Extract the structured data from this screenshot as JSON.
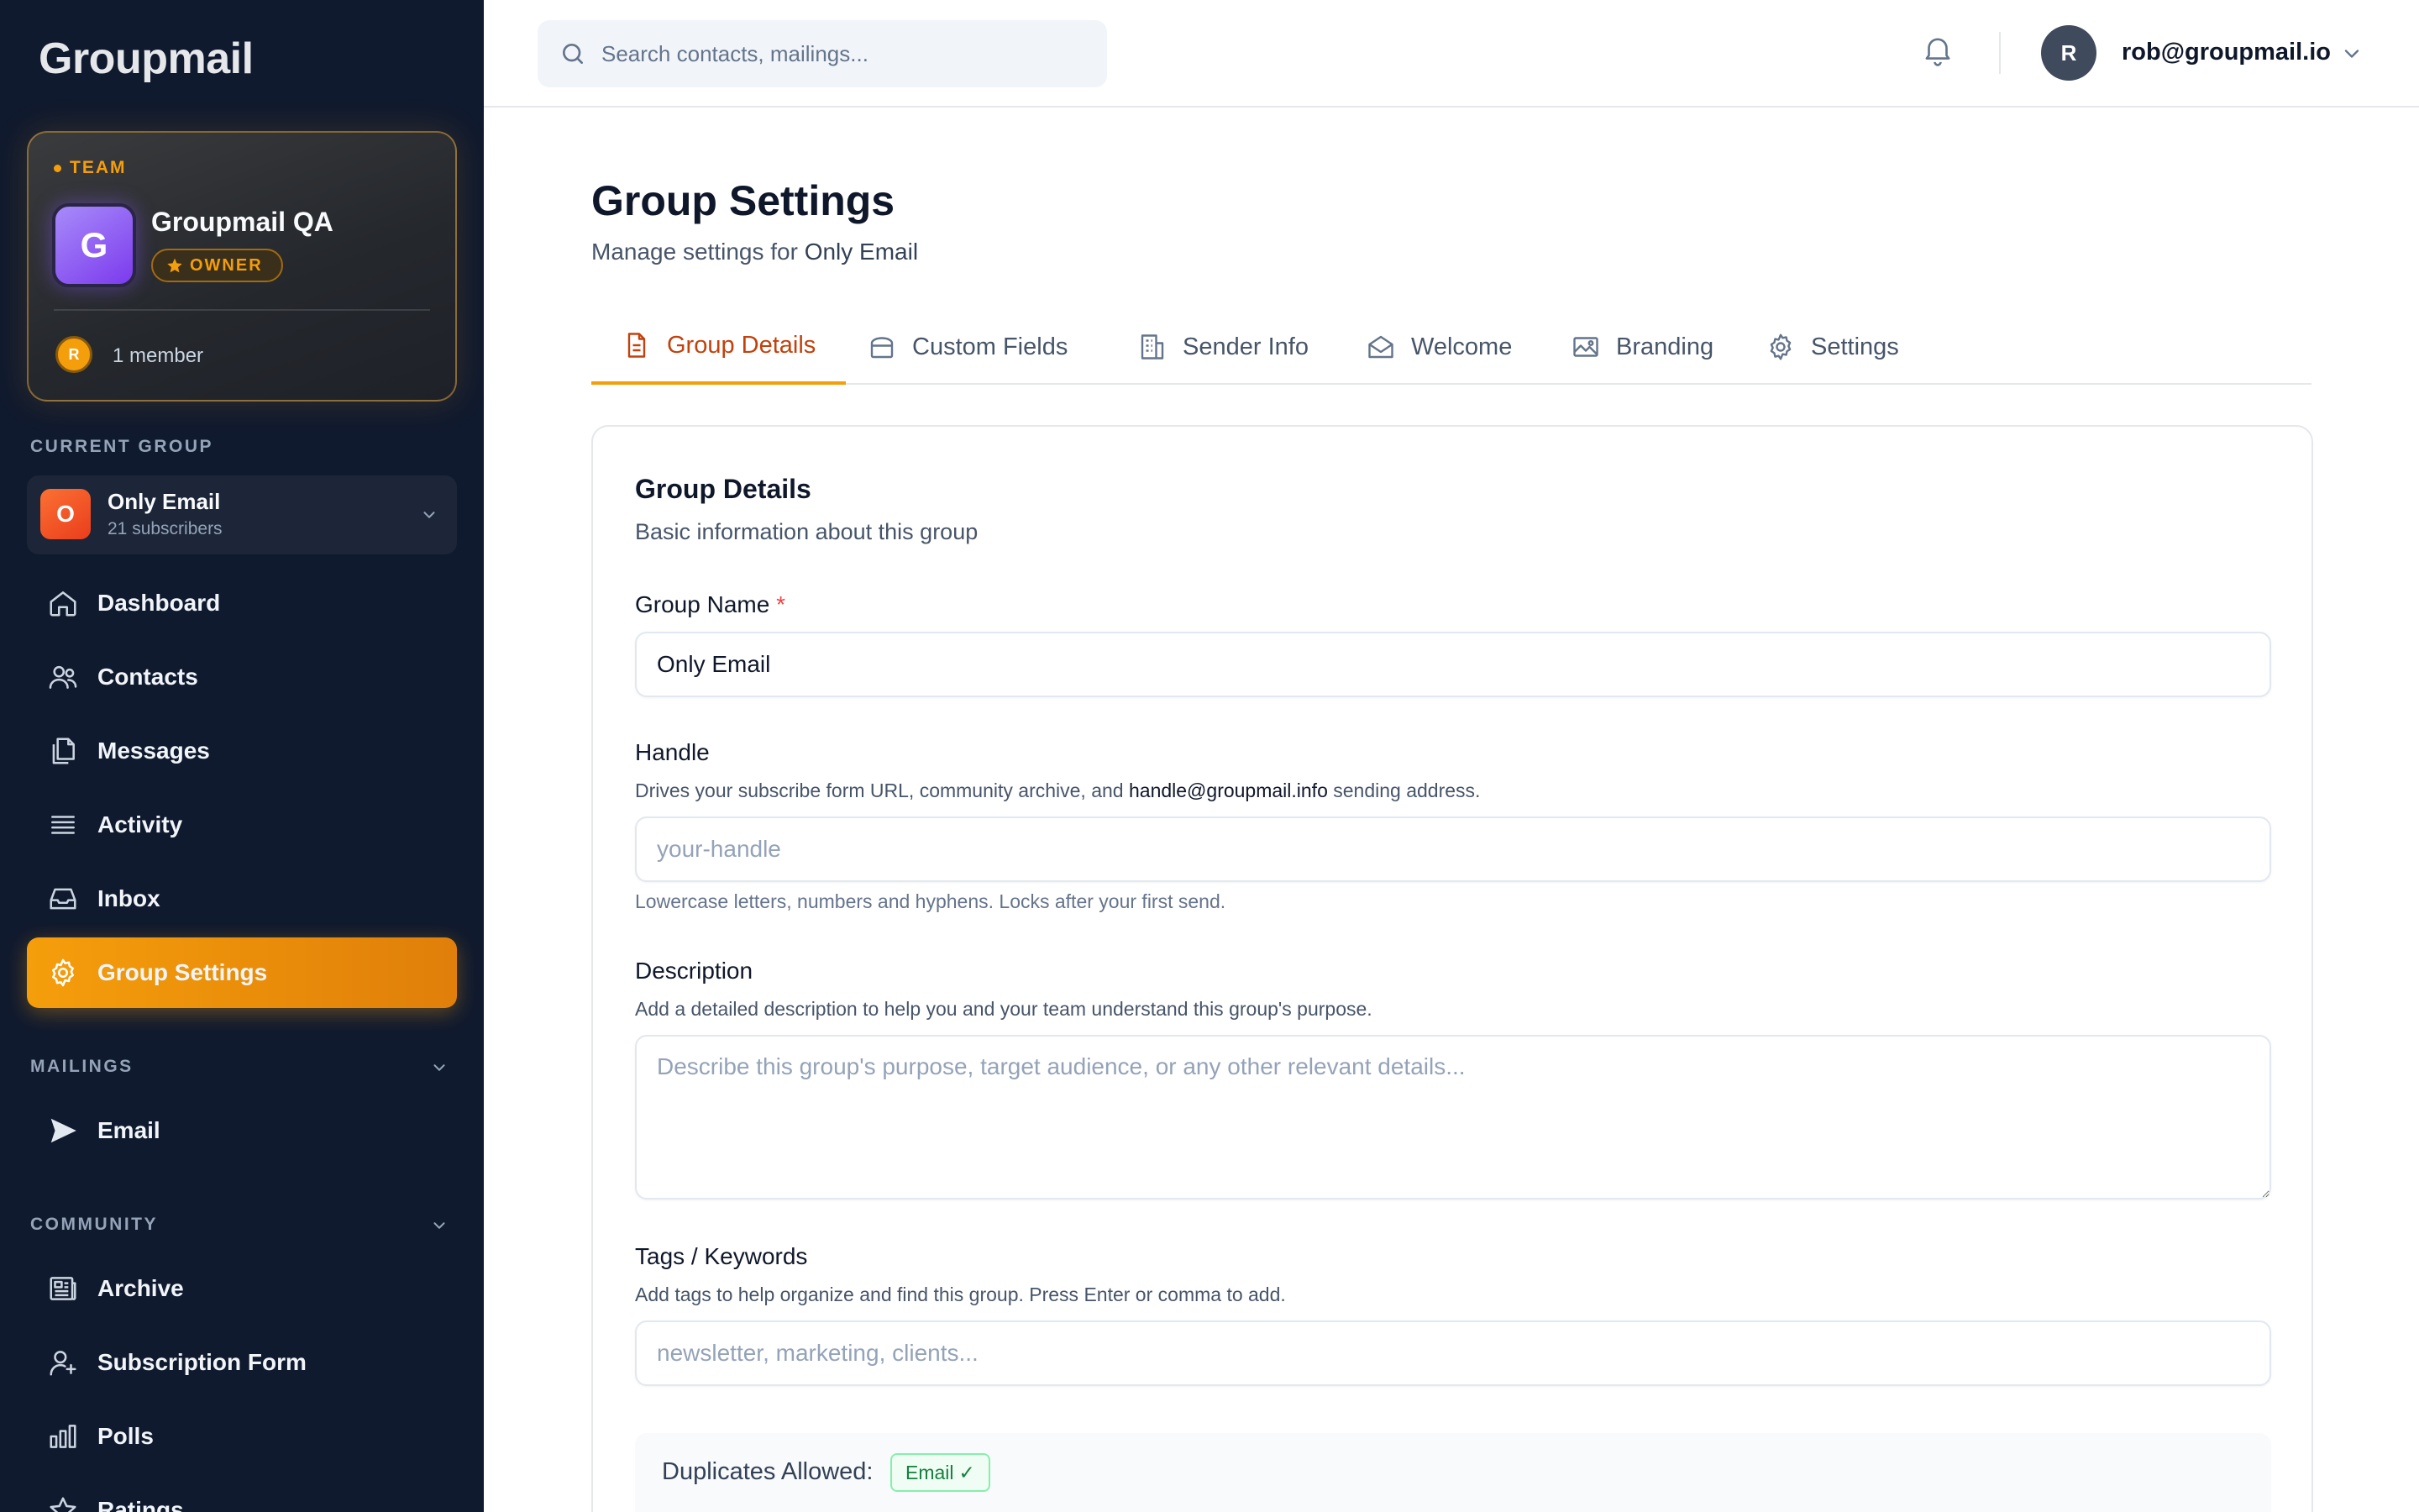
{
  "app": {
    "logo": "Groupmail"
  },
  "team": {
    "label": "TEAM",
    "avatar_letter": "G",
    "name": "Groupmail QA",
    "role_badge": "OWNER",
    "member_avatar_letter": "R",
    "member_count": "1 member"
  },
  "current_group": {
    "section_label": "CURRENT GROUP",
    "icon_letter": "O",
    "name": "Only Email",
    "subscribers": "21 subscribers"
  },
  "nav": {
    "items": [
      {
        "label": "Dashboard",
        "icon": "home-icon",
        "active": false
      },
      {
        "label": "Contacts",
        "icon": "users-icon",
        "active": false
      },
      {
        "label": "Messages",
        "icon": "copy-icon",
        "active": false
      },
      {
        "label": "Activity",
        "icon": "list-icon",
        "active": false
      },
      {
        "label": "Inbox",
        "icon": "inbox-icon",
        "active": false
      },
      {
        "label": "Group Settings",
        "icon": "gear-icon",
        "active": true
      }
    ],
    "mailings_label": "MAILINGS",
    "mailings_items": [
      {
        "label": "Email",
        "icon": "send-icon"
      }
    ],
    "community_label": "COMMUNITY",
    "community_items": [
      {
        "label": "Archive",
        "icon": "newspaper-icon"
      },
      {
        "label": "Subscription Form",
        "icon": "user-plus-icon"
      },
      {
        "label": "Polls",
        "icon": "bar-chart-icon"
      },
      {
        "label": "Ratings",
        "icon": "star-icon"
      }
    ]
  },
  "topbar": {
    "search_placeholder": "Search contacts, mailings...",
    "user_avatar_letter": "R",
    "user_email": "rob@groupmail.io"
  },
  "page": {
    "title": "Group Settings",
    "subtitle_prefix": "Manage settings for",
    "subtitle_group": "Only Email"
  },
  "tabs": [
    {
      "label": "Group Details",
      "icon": "document-icon",
      "active": true
    },
    {
      "label": "Custom Fields",
      "icon": "database-icon",
      "active": false
    },
    {
      "label": "Sender Info",
      "icon": "building-icon",
      "active": false
    },
    {
      "label": "Welcome",
      "icon": "envelope-open-icon",
      "active": false
    },
    {
      "label": "Branding",
      "icon": "image-icon",
      "active": false
    },
    {
      "label": "Settings",
      "icon": "gear-icon",
      "active": false
    }
  ],
  "form": {
    "title": "Group Details",
    "subtitle": "Basic information about this group",
    "group_name": {
      "label": "Group Name",
      "required_mark": "*",
      "value": "Only Email"
    },
    "handle": {
      "label": "Handle",
      "help_prefix": "Drives your subscribe form URL, community archive, and",
      "help_address": "handle@groupmail.info",
      "help_suffix": "sending address.",
      "placeholder": "your-handle",
      "note": "Lowercase letters, numbers and hyphens. Locks after your first send."
    },
    "description": {
      "label": "Description",
      "help": "Add a detailed description to help you and your team understand this group's purpose.",
      "placeholder": "Describe this group's purpose, target audience, or any other relevant details..."
    },
    "tags": {
      "label": "Tags / Keywords",
      "help": "Add tags to help organize and find this group. Press Enter or comma to add.",
      "placeholder": "newsletter, marketing, clients..."
    },
    "duplicates": {
      "label": "Duplicates Allowed:",
      "chip": "Email",
      "chip_check": "✓"
    }
  },
  "colors": {
    "accent": "#f59e0b",
    "sidebar_bg": "#101a2e",
    "required": "#ef4444",
    "chip_green": "#15803d"
  }
}
